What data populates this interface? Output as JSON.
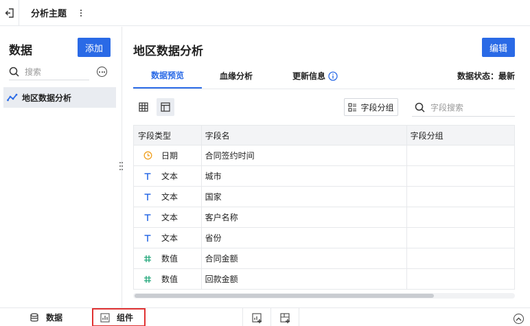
{
  "topbar": {
    "title": "分析主题"
  },
  "left_panel": {
    "title": "数据",
    "add_label": "添加",
    "search_placeholder": "搜索",
    "items": [
      {
        "label": "地区数据分析",
        "selected": true
      }
    ]
  },
  "main": {
    "title": "地区数据分析",
    "edit_label": "编辑",
    "tabs": [
      {
        "label": "数据预览",
        "active": true
      },
      {
        "label": "血缘分析",
        "active": false
      },
      {
        "label": "更新信息",
        "active": false
      }
    ],
    "status": "数据状态：最新",
    "group_button_label": "字段分组",
    "field_search_placeholder": "字段搜索"
  },
  "table": {
    "headers": [
      "字段类型",
      "字段名",
      "字段分组"
    ],
    "rows": [
      {
        "type": "日期",
        "icon": "clock-icon",
        "name": "合同签约时间",
        "group": ""
      },
      {
        "type": "文本",
        "icon": "text-icon",
        "name": "城市",
        "group": ""
      },
      {
        "type": "文本",
        "icon": "text-icon",
        "name": "国家",
        "group": ""
      },
      {
        "type": "文本",
        "icon": "text-icon",
        "name": "客户名称",
        "group": ""
      },
      {
        "type": "文本",
        "icon": "text-icon",
        "name": "省份",
        "group": ""
      },
      {
        "type": "数值",
        "icon": "hash-icon",
        "name": "合同金额",
        "group": ""
      },
      {
        "type": "数值",
        "icon": "hash-icon",
        "name": "回款金额",
        "group": ""
      }
    ]
  },
  "bottombar": {
    "data_label": "数据",
    "component_label": "组件"
  },
  "colors": {
    "accent": "#2a6ae6",
    "date_icon": "#f0a020",
    "text_icon": "#2a6ae6",
    "number_icon": "#21a67a",
    "highlight_border": "#e03131"
  }
}
